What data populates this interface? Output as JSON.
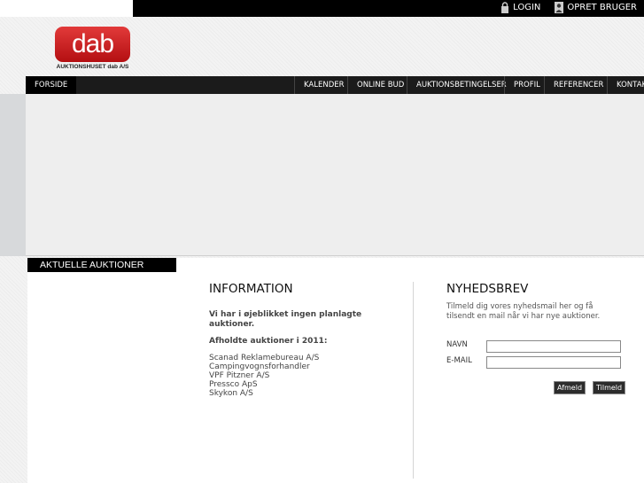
{
  "topbar": {
    "login_label": "LOGIN",
    "create_user_label": "OPRET BRUGER"
  },
  "logo": {
    "text": "dab",
    "subtitle": "AUKTIONSHUSET dab A/S",
    "color": "#c8161b"
  },
  "nav": {
    "items": [
      {
        "label": "FORSIDE"
      },
      {
        "label": "KALENDER"
      },
      {
        "label": "ONLINE BUD"
      },
      {
        "label": "AUKTIONSBETINGELSER"
      },
      {
        "label": "PROFIL"
      },
      {
        "label": "REFERENCER"
      },
      {
        "label": "KONTAKT"
      }
    ]
  },
  "sidebar": {
    "title": "AKTUELLE AUKTIONER"
  },
  "information": {
    "title": "INFORMATION",
    "no_auctions": "Vi har i øjeblikket ingen planlagte auktioner.",
    "held_title": "Afholdte auktioner i 2011:",
    "held": [
      "Scanad Reklamebureau A/S",
      "Campingvognsforhandler",
      "VPF Pitzner A/S",
      "Pressco ApS",
      "Skykon A/S"
    ]
  },
  "newsletter": {
    "title": "NYHEDSBREV",
    "description": "Tilmeld dig vores nyhedsmail her og få tilsendt en mail når vi har nye auktioner.",
    "name_label": "NAVN",
    "name_value": "",
    "email_label": "E-MAIL",
    "email_value": "",
    "unsubscribe_label": "Afmeld",
    "subscribe_label": "Tilmeld"
  }
}
